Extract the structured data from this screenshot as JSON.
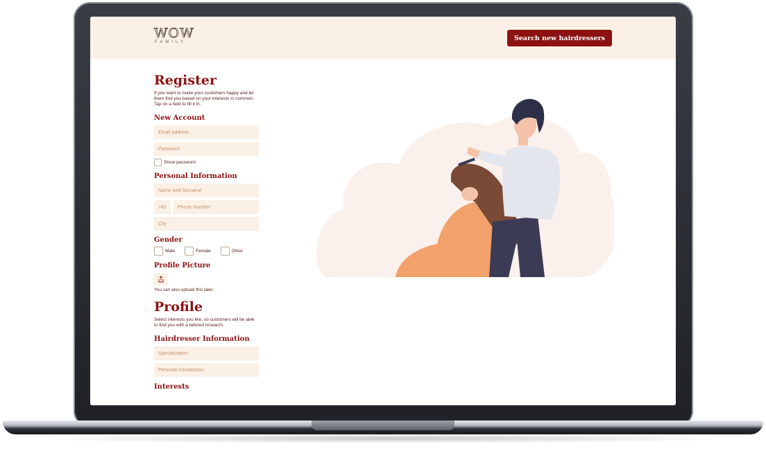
{
  "header": {
    "logo_word": "WOW",
    "logo_sub": "FAMILY",
    "search_button": "Search new hairdressers"
  },
  "register": {
    "title": "Register",
    "description": "If you want to make your customers happy and let them find you based on your interests in common. Tap on a field to fill it in.",
    "new_account_heading": "New Account",
    "email_placeholder": "Email address",
    "password_placeholder": "Password",
    "show_password_label": "Show password",
    "personal_info_heading": "Personal Information",
    "name_placeholder": "Name and Surname",
    "phone_prefix": "+41",
    "phone_placeholder": "Phone Number",
    "city_placeholder": "City",
    "gender_heading": "Gender",
    "gender_options": [
      "Male",
      "Female",
      "Other"
    ],
    "profile_picture_heading": "Profile Picture",
    "upload_note": "You can also upload this later."
  },
  "profile": {
    "title": "Profile",
    "description": "Select interests you like, so customers will be able to find you with a tailored research.",
    "hairdresser_info_heading": "Hairdresser Information",
    "specialization_placeholder": "Specialization",
    "intro_placeholder": "Personal Introduction",
    "interests_heading": "Interests"
  },
  "colors": {
    "accent": "#8c1212",
    "field_bg": "#faf0e6",
    "header_bg": "#faf0e6"
  }
}
